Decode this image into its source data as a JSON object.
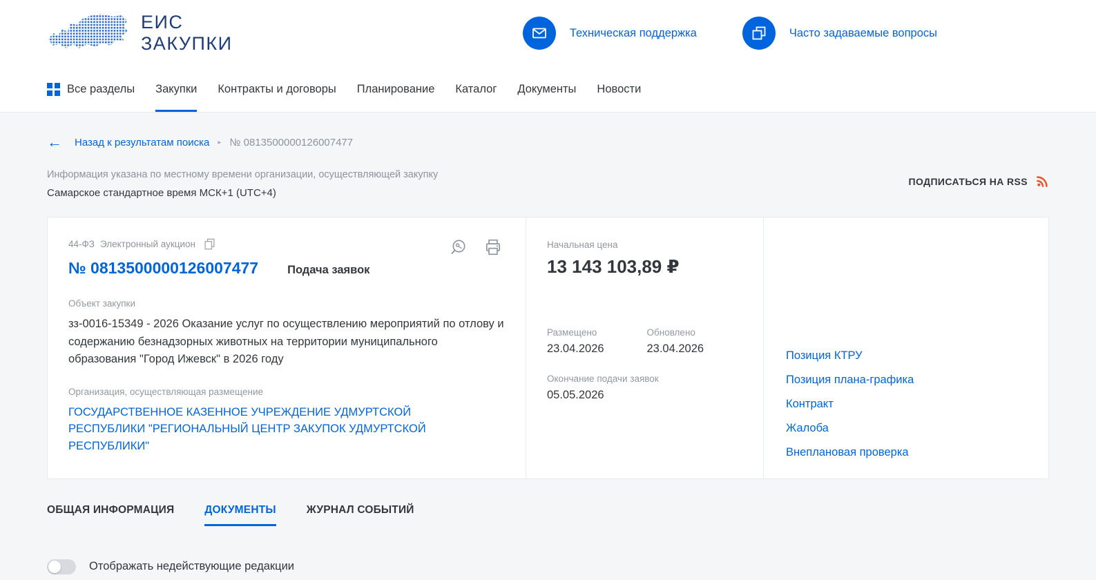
{
  "colors": {
    "accent": "#0065dd",
    "logo": "#1d3c78",
    "rss": "#e8572f"
  },
  "header": {
    "logo_line1": "ЕИС",
    "logo_line2": "ЗАКУПКИ",
    "support_label": "Техническая поддержка",
    "faq_label": "Часто задаваемые вопросы"
  },
  "nav": {
    "all_sections": "Все разделы",
    "items": [
      {
        "label": "Закупки",
        "active": true
      },
      {
        "label": "Контракты и договоры",
        "active": false
      },
      {
        "label": "Планирование",
        "active": false
      },
      {
        "label": "Каталог",
        "active": false
      },
      {
        "label": "Документы",
        "active": false
      },
      {
        "label": "Новости",
        "active": false
      }
    ]
  },
  "breadcrumb": {
    "back_label": "Назад к результатам поиска",
    "current": "№ 0813500000126007477"
  },
  "timezone": {
    "line1": "Информация указана по местному времени организации, осуществляющей закупку",
    "line2": "Самарское стандартное время МСК+1 (UTC+4)"
  },
  "rss": {
    "label": "ПОДПИСАТЬСЯ НА RSS"
  },
  "card": {
    "law_type": "44-ФЗ",
    "procedure_type": "Электронный аукцион",
    "number": "№ 0813500000126007477",
    "status": "Подача заявок",
    "object_label": "Объект закупки",
    "object_text": "зз-0016-15349 - 2026 Оказание услуг по осуществлению мероприятий по отлову и содержанию безнадзорных животных на территории муниципального образования \"Город Ижевск\" в 2026 году",
    "org_label": "Организация, осуществляющая размещение",
    "org_name": "ГОСУДАРСТВЕННОЕ КАЗЕННОЕ УЧРЕЖДЕНИЕ УДМУРТСКОЙ РЕСПУБЛИКИ \"РЕГИОНАЛЬНЫЙ ЦЕНТР ЗАКУПОК УДМУРТСКОЙ РЕСПУБЛИКИ\"",
    "price_label": "Начальная цена",
    "price_value": "13 143 103,89 ₽",
    "placed_label": "Размещено",
    "placed_date": "23.04.2026",
    "updated_label": "Обновлено",
    "updated_date": "23.04.2026",
    "deadline_label": "Окончание подачи заявок",
    "deadline_date": "05.05.2026",
    "links": [
      "Позиция КТРУ",
      "Позиция плана-графика",
      "Контракт",
      "Жалоба",
      "Внеплановая проверка"
    ]
  },
  "tabs": [
    {
      "label": "ОБЩАЯ ИНФОРМАЦИЯ",
      "active": false
    },
    {
      "label": "ДОКУМЕНТЫ",
      "active": true
    },
    {
      "label": "ЖУРНАЛ СОБЫТИЙ",
      "active": false
    }
  ],
  "toggle": {
    "label": "Отображать недействующие редакции",
    "state": "off"
  }
}
